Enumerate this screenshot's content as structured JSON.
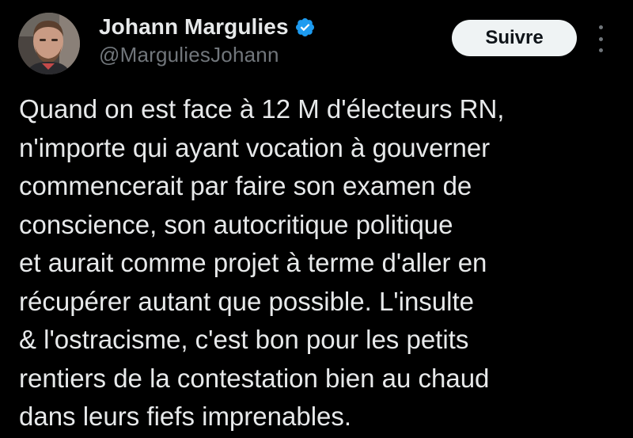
{
  "author": {
    "display_name": "Johann Margulies",
    "handle": "@MarguliesJohann",
    "verified": true,
    "verified_icon": "verified-badge-icon",
    "avatar_icon": "avatar-photo"
  },
  "actions": {
    "follow_label": "Suivre",
    "more_icon": "more-vertical-icon"
  },
  "tweet": {
    "lines": [
      "Quand on est face à 12 M d'électeurs RN,",
      "n'importe qui ayant vocation à gouverner",
      "commencerait par faire son examen de",
      "conscience, son autocritique politique",
      "et aurait comme projet à terme d'aller en",
      "récupérer autant que possible. L'insulte",
      "& l'ostracisme, c'est bon pour les petits",
      "rentiers de la contestation bien au chaud",
      "dans leurs fiefs imprenables."
    ]
  },
  "colors": {
    "background": "#000000",
    "text_primary": "#e7e9ea",
    "text_secondary": "#71767b",
    "verified_blue": "#1d9bf0",
    "button_bg": "#eff3f4",
    "button_text": "#0f1419"
  }
}
